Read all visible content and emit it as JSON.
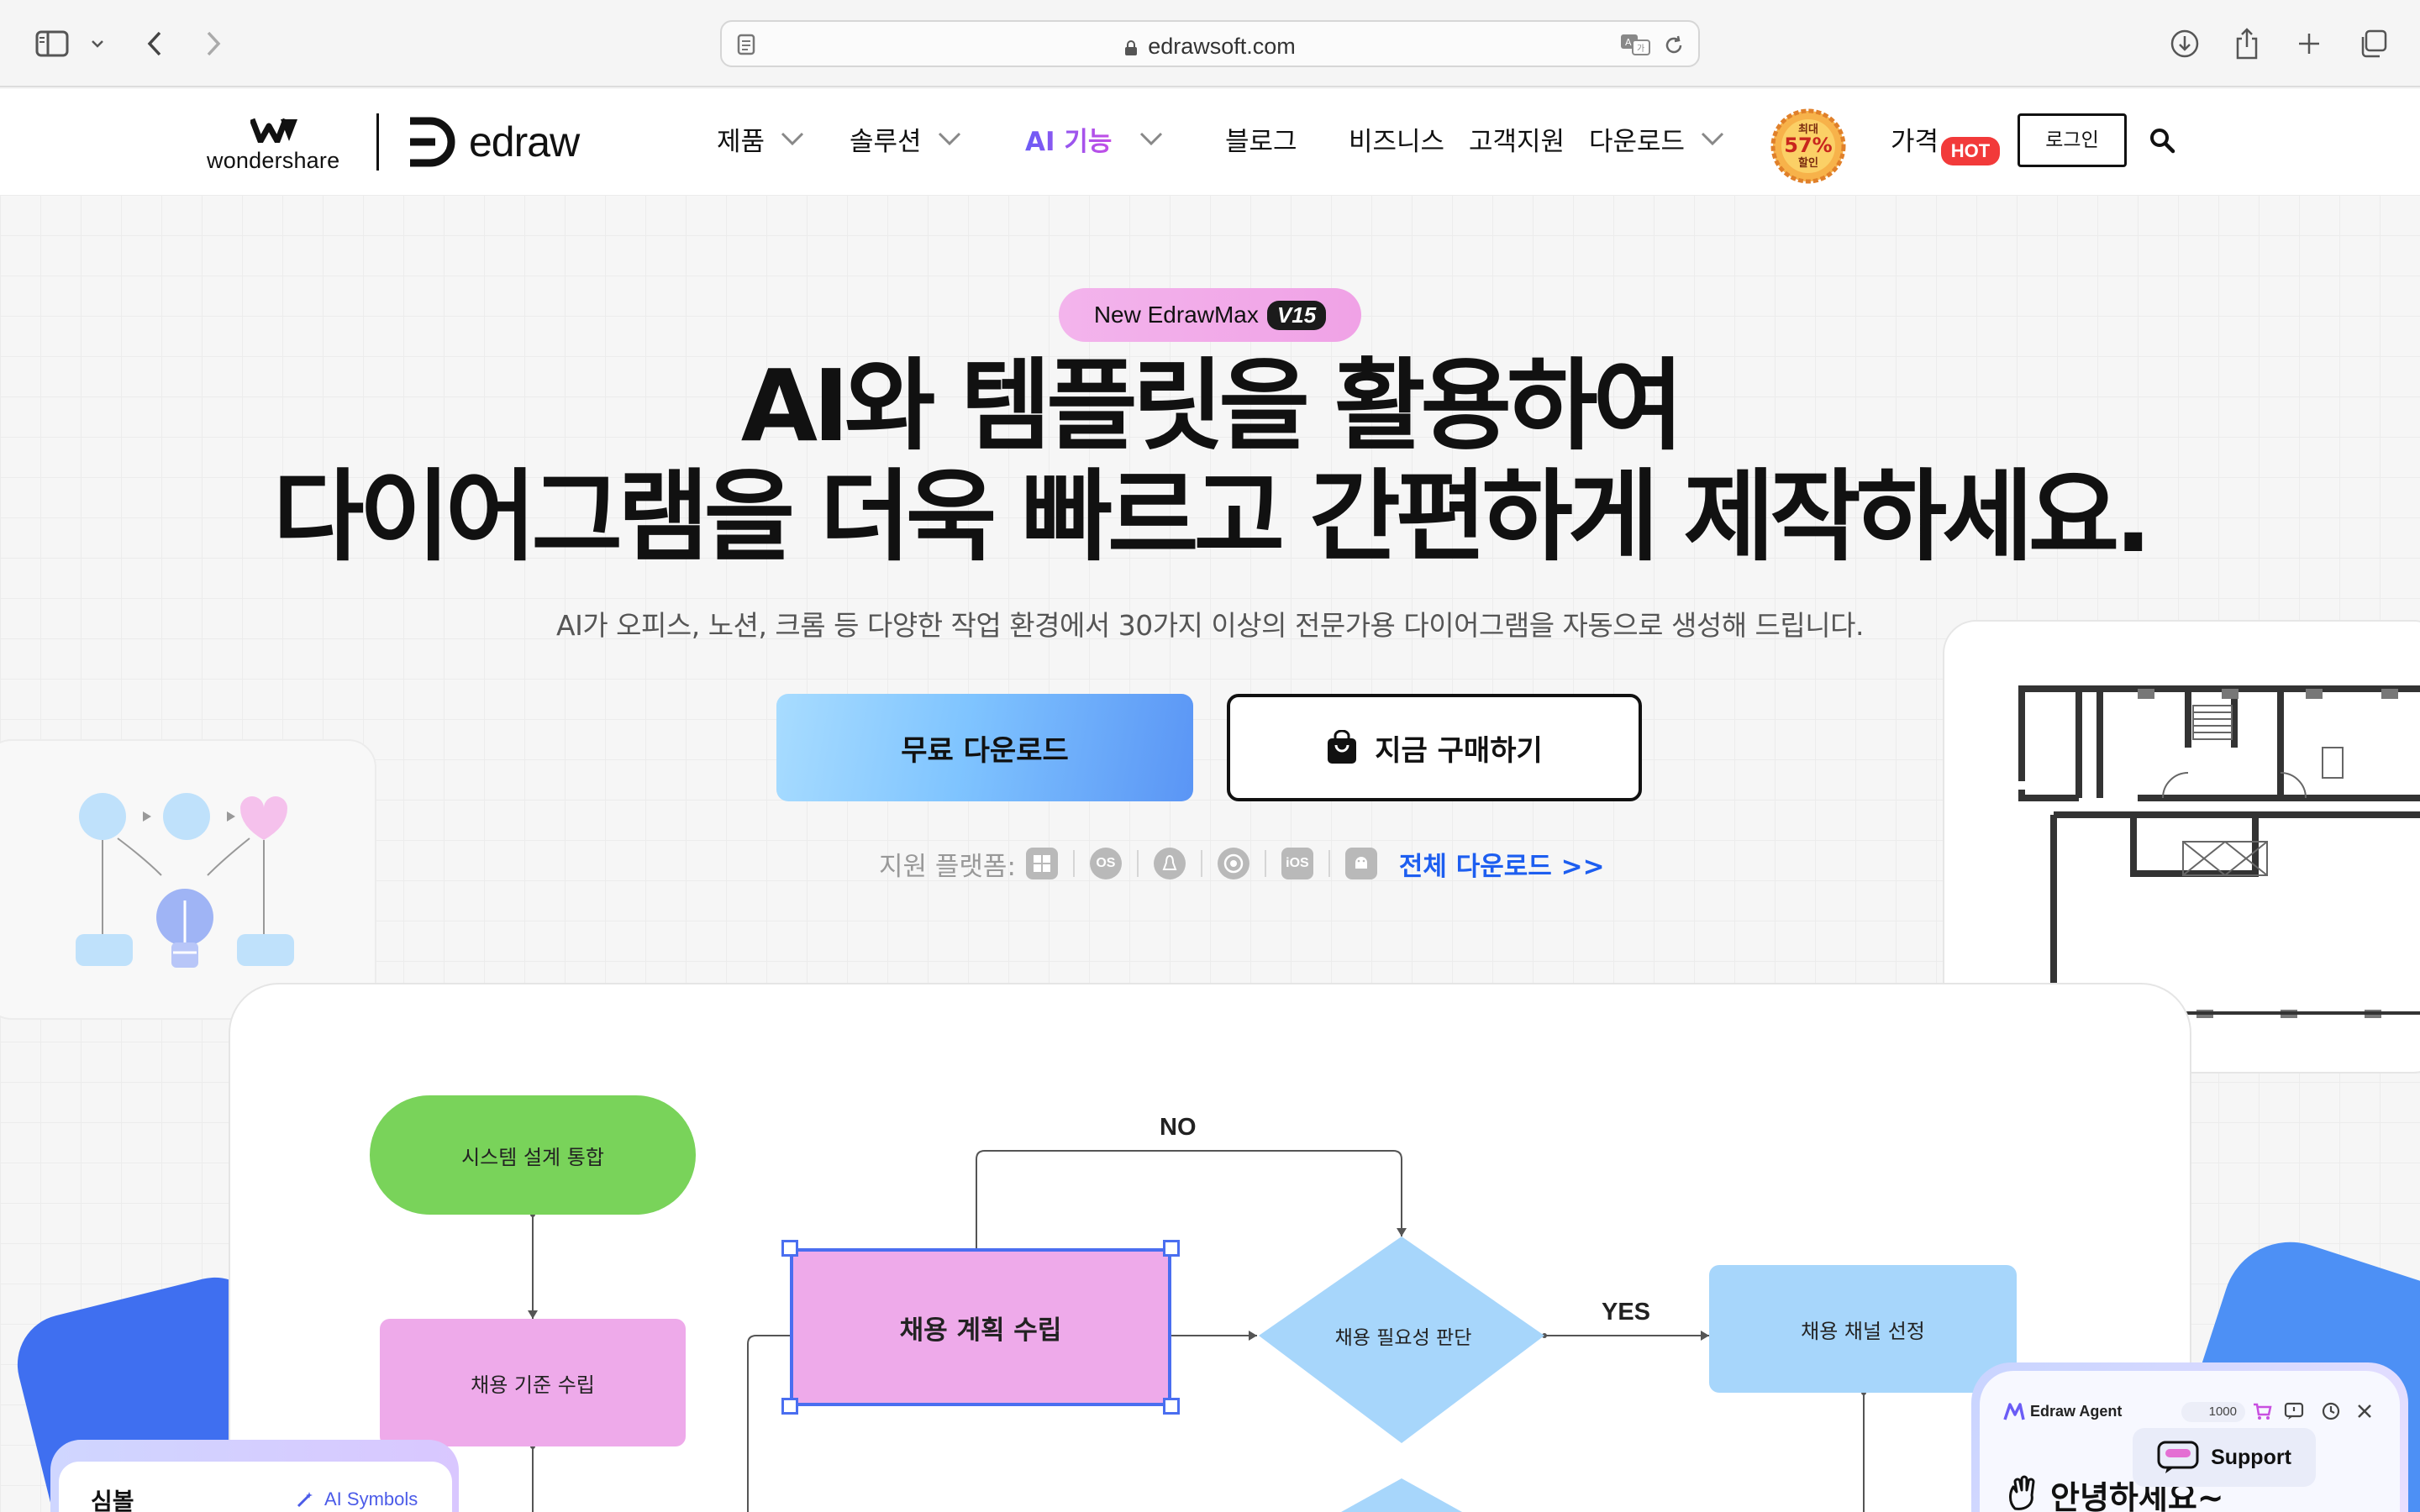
{
  "browser": {
    "url": "edrawsoft.com"
  },
  "header": {
    "brand_parent": "wondershare",
    "brand_product": "edraw",
    "nav": [
      {
        "label": "제품",
        "has_dropdown": true
      },
      {
        "label": "솔루션",
        "has_dropdown": true
      },
      {
        "label": "AI 기능",
        "has_dropdown": true
      },
      {
        "label": "블로그",
        "has_dropdown": false
      },
      {
        "label": "비즈니스",
        "has_dropdown": false
      },
      {
        "label": "고객지원",
        "has_dropdown": false
      },
      {
        "label": "다운로드",
        "has_dropdown": true
      },
      {
        "label": "가격",
        "has_dropdown": false
      }
    ],
    "promo_badge": {
      "top": "최대",
      "value": "57%",
      "bottom": "할인"
    },
    "hot_badge": "HOT",
    "login": "로그인"
  },
  "hero": {
    "pill_text": "New EdrawMax",
    "pill_version": "V15",
    "headline_1": "AI와 템플릿을 활용하여",
    "headline_2": "다이어그램을 더욱 빠르고 간편하게 제작하세요.",
    "subline": "AI가 오피스, 노션, 크롬 등 다양한 작업 환경에서 30가지 이상의 전문가용 다이어그램을 자동으로 생성해 드립니다.",
    "download_button": "무료 다운로드",
    "buy_button": "지금 구매하기",
    "platforms_label": "지원 플랫폼:",
    "all_download": "전체 다운로드 >>"
  },
  "diagram": {
    "nodes": {
      "system": "시스템 설계 통합",
      "standard": "채용 기준 수립",
      "plan": "채용 계획 수립",
      "decision": "채용 필요성 판단",
      "channel": "채용 채널 선정"
    },
    "labels": {
      "no": "NO",
      "yes": "YES"
    }
  },
  "symbols_panel": {
    "title": "심볼",
    "ai_link": "AI Symbols"
  },
  "agent": {
    "title": "Edraw Agent",
    "credits": "1000",
    "greeting": "안녕하세요~",
    "support": "Support"
  },
  "colors": {
    "accent_blue": "#1d5ef0",
    "selection": "#4a6ef0",
    "node_green": "#79d35a",
    "node_pink": "#eeaaea",
    "node_blue": "#a7d6fb",
    "hot_red": "#f23a3a"
  }
}
